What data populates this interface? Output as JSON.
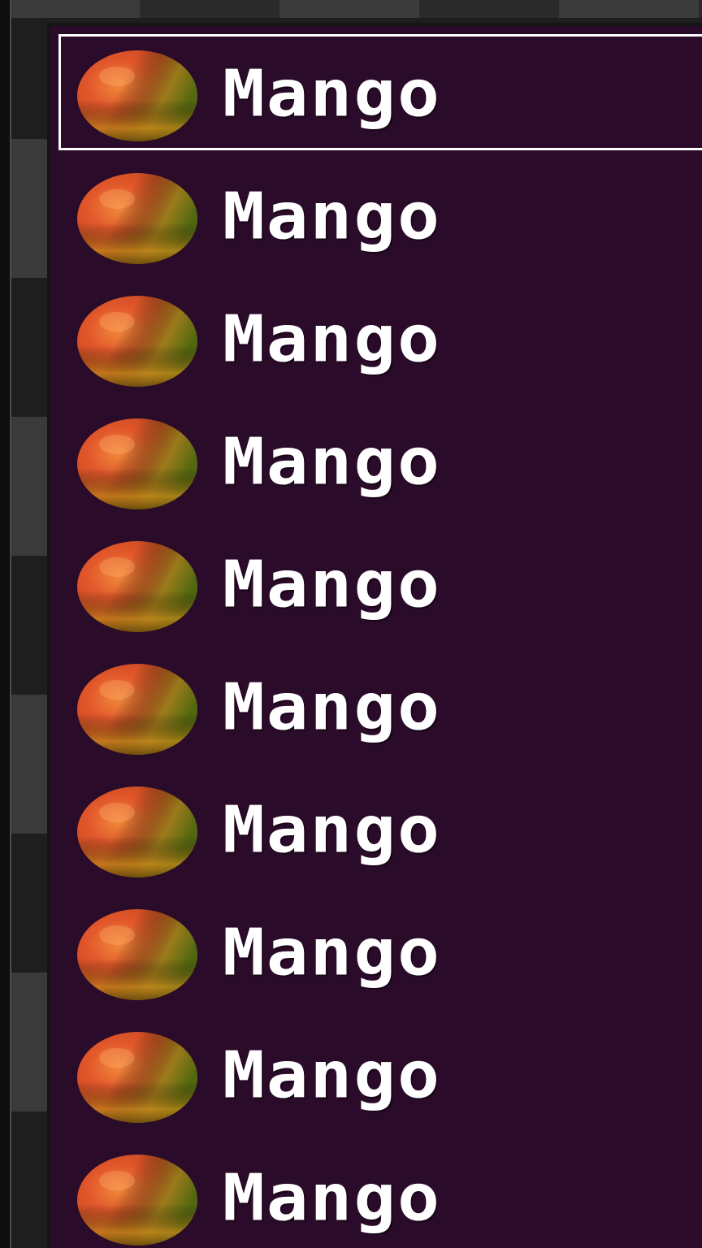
{
  "inventory": {
    "selected_index": 0,
    "items": [
      {
        "label": "Mango",
        "icon": "mango-icon"
      },
      {
        "label": "Mango",
        "icon": "mango-icon"
      },
      {
        "label": "Mango",
        "icon": "mango-icon"
      },
      {
        "label": "Mango",
        "icon": "mango-icon"
      },
      {
        "label": "Mango",
        "icon": "mango-icon"
      },
      {
        "label": "Mango",
        "icon": "mango-icon"
      },
      {
        "label": "Mango",
        "icon": "mango-icon"
      },
      {
        "label": "Mango",
        "icon": "mango-icon"
      },
      {
        "label": "Mango",
        "icon": "mango-icon"
      },
      {
        "label": "Mango",
        "icon": "mango-icon"
      }
    ]
  },
  "colors": {
    "panel_bg": "#2a0b29",
    "selection_border": "#ffffff",
    "label": "#ffffff"
  }
}
